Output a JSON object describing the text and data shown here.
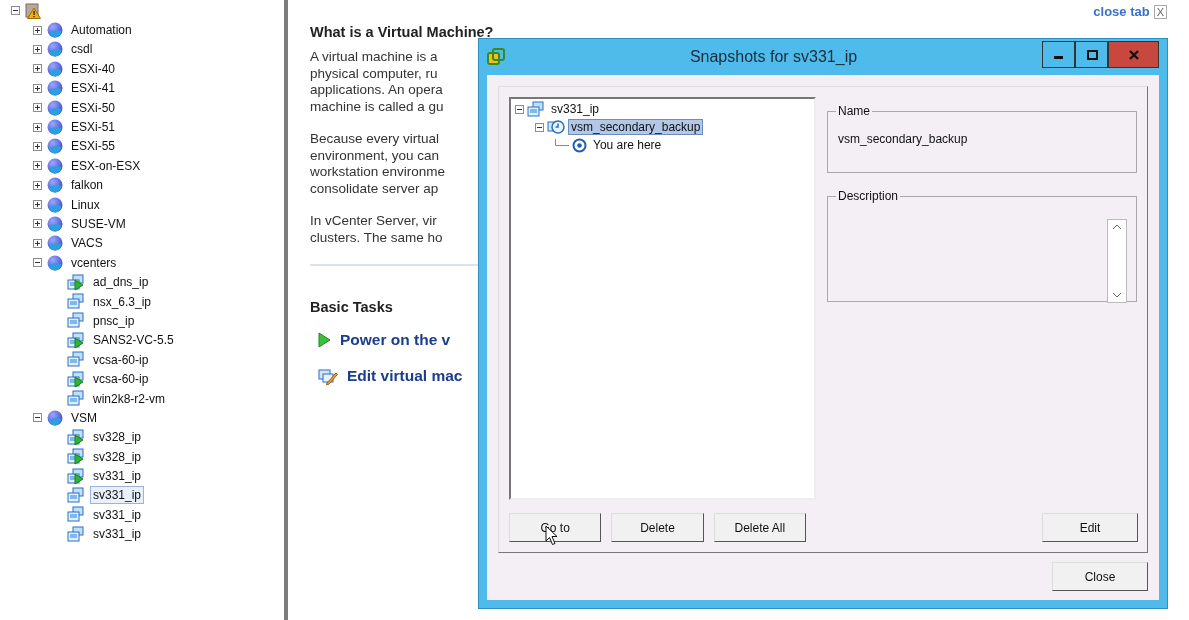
{
  "inventory_tree": {
    "kind": "root",
    "warning": true,
    "expanded": true,
    "children": [
      {
        "kind": "folder",
        "label": "Automation",
        "expanded": false,
        "selected": false
      },
      {
        "kind": "folder",
        "label": "csdl",
        "expanded": false,
        "selected": false
      },
      {
        "kind": "folder",
        "label": "ESXi-40",
        "expanded": false,
        "selected": false
      },
      {
        "kind": "folder",
        "label": "ESXi-41",
        "expanded": false,
        "selected": false
      },
      {
        "kind": "folder",
        "label": "ESXi-50",
        "expanded": false,
        "selected": false
      },
      {
        "kind": "folder",
        "label": "ESXi-51",
        "expanded": false,
        "selected": false
      },
      {
        "kind": "folder",
        "label": "ESXi-55",
        "expanded": false,
        "selected": false
      },
      {
        "kind": "folder",
        "label": "ESX-on-ESX",
        "expanded": false,
        "selected": false
      },
      {
        "kind": "folder",
        "label": "falkon",
        "expanded": false,
        "selected": false
      },
      {
        "kind": "folder",
        "label": "Linux",
        "expanded": false,
        "selected": false
      },
      {
        "kind": "folder",
        "label": "SUSE-VM",
        "expanded": false,
        "selected": false
      },
      {
        "kind": "folder",
        "label": "VACS",
        "expanded": false,
        "selected": false
      },
      {
        "kind": "folder",
        "label": "vcenters",
        "expanded": true,
        "selected": false,
        "children": [
          {
            "kind": "vm",
            "label": "ad_dns_ip",
            "powered_on": true,
            "selected": false
          },
          {
            "kind": "vm",
            "label": "nsx_6.3_ip",
            "powered_on": false,
            "selected": false
          },
          {
            "kind": "vm",
            "label": "pnsc_ip",
            "powered_on": false,
            "selected": false
          },
          {
            "kind": "vm",
            "label": "SANS2-VC-5.5",
            "powered_on": true,
            "selected": false
          },
          {
            "kind": "vm",
            "label": "vcsa-60-ip",
            "powered_on": false,
            "selected": false
          },
          {
            "kind": "vm",
            "label": "vcsa-60-ip",
            "powered_on": true,
            "selected": false
          },
          {
            "kind": "vm",
            "label": "win2k8-r2-vm",
            "powered_on": false,
            "selected": false
          }
        ]
      },
      {
        "kind": "folder",
        "label": "VSM",
        "expanded": true,
        "selected": false,
        "children": [
          {
            "kind": "vm",
            "label": "sv328_ip",
            "powered_on": true,
            "selected": false
          },
          {
            "kind": "vm",
            "label": "sv328_ip",
            "powered_on": true,
            "selected": false
          },
          {
            "kind": "vm",
            "label": "sv331_ip",
            "powered_on": true,
            "selected": false
          },
          {
            "kind": "vm",
            "label": "sv331_ip",
            "powered_on": false,
            "selected": true
          },
          {
            "kind": "vm",
            "label": "sv331_ip",
            "powered_on": false,
            "selected": false
          },
          {
            "kind": "vm",
            "label": "sv331_ip",
            "powered_on": false,
            "selected": false
          }
        ]
      }
    ]
  },
  "close_tab": {
    "label": "close tab",
    "close_glyph": "X"
  },
  "summary": {
    "heading": "What is a Virtual Machine?",
    "paragraphs": [
      [
        "A virtual machine is a",
        "physical computer, ru",
        "applications. An opera",
        "machine is called a gu"
      ],
      [
        "Because every virtual",
        "environment, you can",
        "workstation environme",
        "consolidate server ap"
      ],
      [
        "In vCenter Server, vir",
        "clusters. The same ho"
      ]
    ],
    "tasks_heading": "Basic Tasks",
    "tasks": [
      {
        "kind": "power",
        "label": "Power on the v"
      },
      {
        "kind": "edit",
        "label": "Edit virtual mac"
      }
    ]
  },
  "dialog": {
    "title": "Snapshots for sv331_ip",
    "snapshot_tree": {
      "kind": "vm",
      "label": "sv331_ip",
      "expanded": true,
      "selected": false,
      "children": [
        {
          "kind": "snapshot",
          "label": "vsm_secondary_backup",
          "expanded": true,
          "selected": true,
          "children": [
            {
              "kind": "current",
              "label": "You are here",
              "selected": false
            }
          ]
        }
      ]
    },
    "name_group": {
      "legend": "Name",
      "value": "vsm_secondary_backup"
    },
    "description_group": {
      "legend": "Description"
    },
    "tree_buttons": [
      "Go to",
      "Delete",
      "Delete All"
    ],
    "edit_button": "Edit",
    "close_button": "Close"
  }
}
